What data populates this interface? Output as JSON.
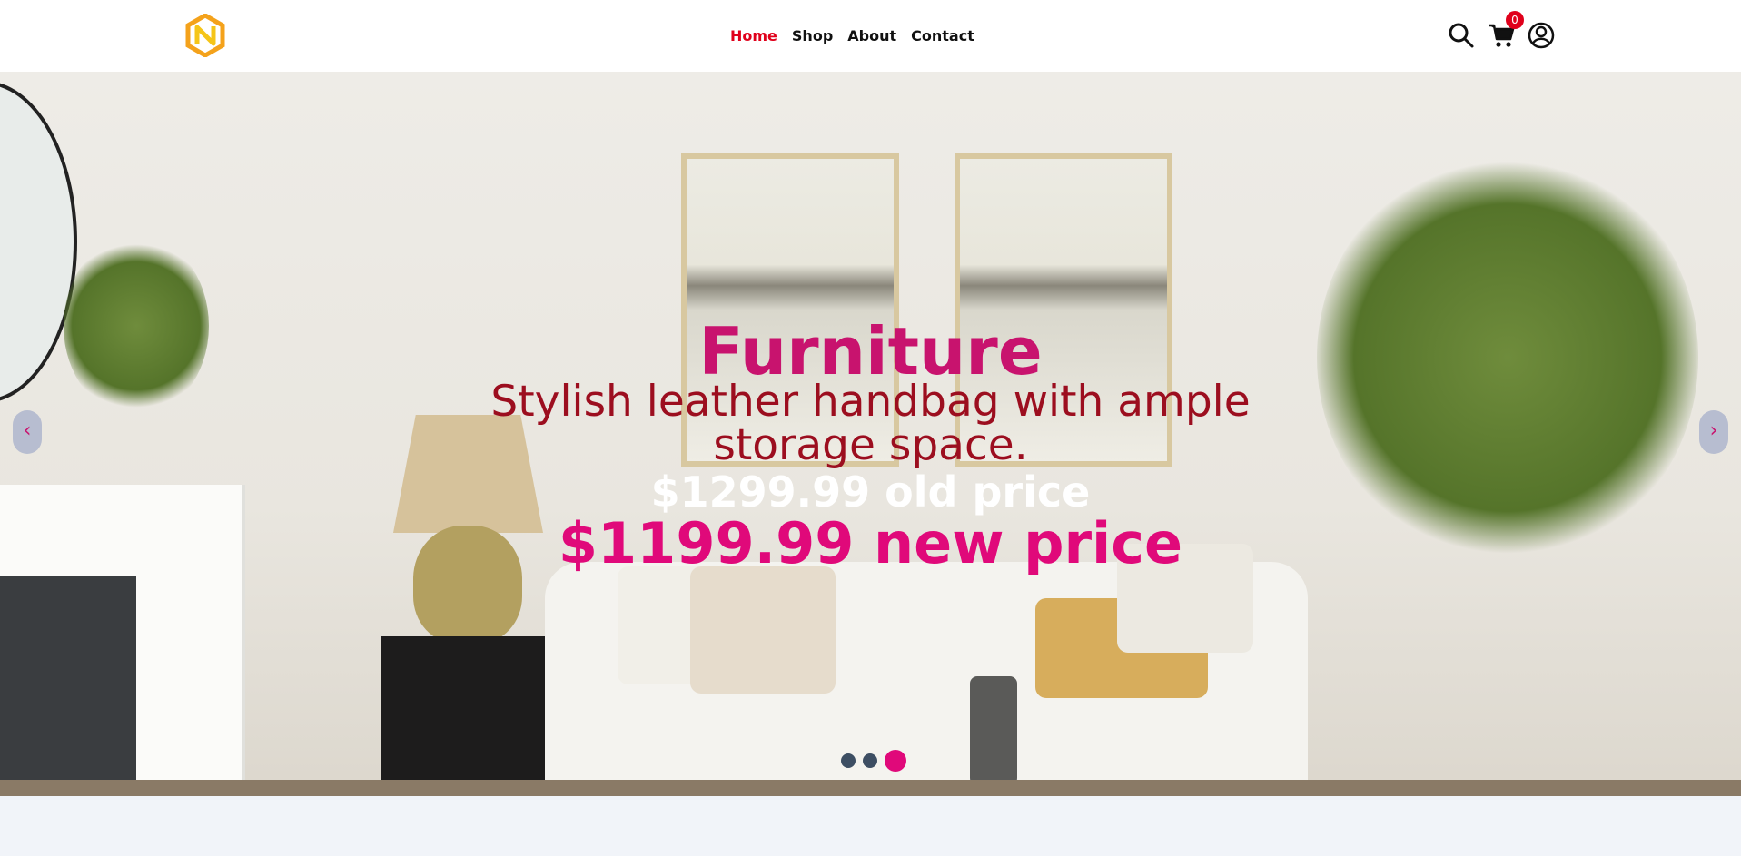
{
  "nav": {
    "items": [
      {
        "label": "Home",
        "active": true
      },
      {
        "label": "Shop",
        "active": false
      },
      {
        "label": "About",
        "active": false
      },
      {
        "label": "Contact",
        "active": false
      }
    ]
  },
  "header_icons": {
    "search": "search-icon",
    "cart": "cart-icon",
    "account": "user-account-icon",
    "cart_count": "0"
  },
  "hero": {
    "title": "Furniture",
    "description": "Stylish leather handbag with ample storage space.",
    "old_price": "$1299.99 old price",
    "new_price": "$1199.99 new price",
    "prev_arrow": "‹",
    "next_arrow": "›",
    "slides": [
      false,
      false,
      true
    ]
  },
  "colors": {
    "accent": "#e0097a",
    "active_nav": "#e0001b",
    "title": "#c8136e",
    "description": "#9c0e1f"
  }
}
